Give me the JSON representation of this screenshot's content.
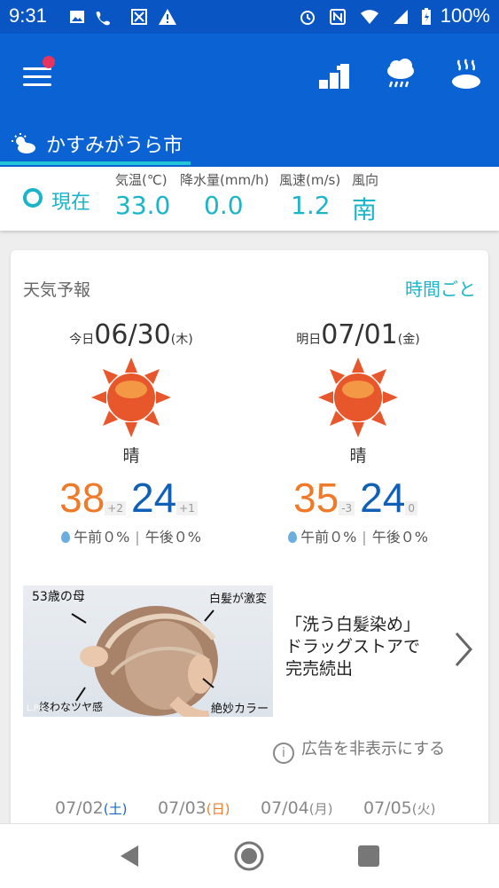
{
  "status_bar": {
    "time": "9:31",
    "battery_text": "100%",
    "icons": [
      "image-icon",
      "wifi-calling-icon",
      "box-x-icon",
      "warning-icon",
      "alarm-icon",
      "nfc-icon",
      "wifi-icon",
      "signal-icon",
      "battery-charging-icon"
    ]
  },
  "app_bar": {
    "menu_icon": "hamburger-menu-icon",
    "icons": [
      "ranking-icon",
      "rain-cloud-icon",
      "hot-spring-icon"
    ],
    "city_tab": "かすみがうら市"
  },
  "current": {
    "label": "現在",
    "metrics": [
      {
        "label": "気温(℃)",
        "value": "33.0"
      },
      {
        "label": "降水量(mm/h)",
        "value": "0.0"
      },
      {
        "label": "風速(m/s)",
        "value": "1.2"
      },
      {
        "label": "風向",
        "value": "南"
      }
    ]
  },
  "forecast": {
    "title": "天気予報",
    "hourly_link": "時間ごと",
    "days": [
      {
        "prefix": "今日",
        "date": "06/30",
        "weekday": "(木)",
        "condition": "晴",
        "high": "38",
        "high_diff": "+2",
        "low": "24",
        "low_diff": "+1",
        "am": "午前０%",
        "pm": "午後０%"
      },
      {
        "prefix": "明日",
        "date": "07/01",
        "weekday": "(金)",
        "condition": "晴",
        "high": "35",
        "high_diff": "-3",
        "low": "24",
        "low_diff": "0",
        "am": "午前０%",
        "pm": "午後０%"
      }
    ]
  },
  "ad": {
    "img_text_1": "53歳の母",
    "img_text_2": "白髪が激変",
    "img_text_3": "絶妙カラー",
    "img_text_4": "終わなツヤ感",
    "img_text_5": "L.PR",
    "line1": "「洗う白髪染め」",
    "line2": "ドラッグストアで",
    "line3": "完売続出",
    "hide_label": "広告を非表示にする"
  },
  "weekly_dates": [
    {
      "date": "07/02",
      "weekday": "(土)",
      "wk_color": "#1a66c9"
    },
    {
      "date": "07/03",
      "weekday": "(日)",
      "wk_color": "#ef7a2a"
    },
    {
      "date": "07/04",
      "weekday": "(月)",
      "wk_color": "#888888"
    },
    {
      "date": "07/05",
      "weekday": "(火)",
      "wk_color": "#888888"
    }
  ],
  "colors": {
    "primary": "#0a62d3",
    "accent": "#1ab5c9",
    "high": "#ef7a2a",
    "low": "#1160b8"
  }
}
